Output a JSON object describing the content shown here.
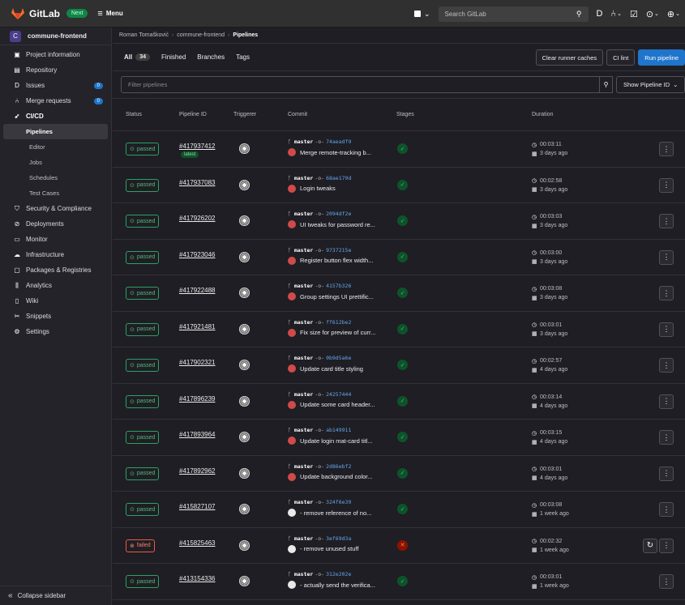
{
  "topbar": {
    "brand": "GitLab",
    "next_badge": "Next",
    "menu_label": "Menu",
    "search_placeholder": "Search GitLab"
  },
  "sidebar": {
    "project_initial": "C",
    "project_name": "commune-frontend",
    "items": [
      {
        "label": "Project information",
        "icon": "info-icon"
      },
      {
        "label": "Repository",
        "icon": "doc-icon"
      },
      {
        "label": "Issues",
        "icon": "issues-icon",
        "count": "0"
      },
      {
        "label": "Merge requests",
        "icon": "merge-request-icon",
        "count": "0"
      },
      {
        "label": "CI/CD",
        "icon": "rocket-icon"
      }
    ],
    "cicd_sub": [
      "Pipelines",
      "Editor",
      "Jobs",
      "Schedules",
      "Test Cases"
    ],
    "items_after": [
      {
        "label": "Security & Compliance",
        "icon": "shield-icon"
      },
      {
        "label": "Deployments",
        "icon": "deployments-icon"
      },
      {
        "label": "Monitor",
        "icon": "monitor-icon"
      },
      {
        "label": "Infrastructure",
        "icon": "cloud-icon"
      },
      {
        "label": "Packages & Registries",
        "icon": "package-icon"
      },
      {
        "label": "Analytics",
        "icon": "chart-icon"
      },
      {
        "label": "Wiki",
        "icon": "book-icon"
      },
      {
        "label": "Snippets",
        "icon": "scissors-icon"
      },
      {
        "label": "Settings",
        "icon": "gear-icon"
      }
    ],
    "collapse_label": "Collapse sidebar"
  },
  "breadcrumb": [
    "Roman Tomašković",
    "commune-frontend",
    "Pipelines"
  ],
  "tabs": [
    {
      "label": "All",
      "count": "34"
    },
    {
      "label": "Finished"
    },
    {
      "label": "Branches"
    },
    {
      "label": "Tags"
    }
  ],
  "actions": {
    "clear_caches": "Clear runner caches",
    "ci_lint": "CI lint",
    "run_pipeline": "Run pipeline"
  },
  "filter": {
    "placeholder": "Filter pipelines",
    "id_dropdown": "Show Pipeline ID"
  },
  "columns": [
    "Status",
    "Pipeline ID",
    "Triggerer",
    "Commit",
    "Stages",
    "Duration"
  ],
  "pipelines": [
    {
      "status": "passed",
      "id": "#417937412",
      "latest": "latest",
      "branch": "master",
      "sha": "74aeadf9",
      "message": "Merge remote-tracking b...",
      "avatar": "red",
      "duration": "00:03:11",
      "finished": "3 days ago"
    },
    {
      "status": "passed",
      "id": "#417937083",
      "branch": "master",
      "sha": "68ae179d",
      "message": "Login tweaks",
      "avatar": "red",
      "duration": "00:02:58",
      "finished": "3 days ago"
    },
    {
      "status": "passed",
      "id": "#417926202",
      "branch": "master",
      "sha": "2094df2e",
      "message": "UI tweaks for password re...",
      "avatar": "red",
      "duration": "00:03:03",
      "finished": "3 days ago"
    },
    {
      "status": "passed",
      "id": "#417923046",
      "branch": "master",
      "sha": "9737215e",
      "message": "Register button flex width...",
      "avatar": "red",
      "duration": "00:03:00",
      "finished": "3 days ago"
    },
    {
      "status": "passed",
      "id": "#417922488",
      "branch": "master",
      "sha": "4157b326",
      "message": "Group settings UI prettific...",
      "avatar": "red",
      "duration": "00:03:08",
      "finished": "3 days ago"
    },
    {
      "status": "passed",
      "id": "#417921481",
      "branch": "master",
      "sha": "ff612be2",
      "message": "Fix size for preview of curr...",
      "avatar": "red",
      "duration": "00:03:01",
      "finished": "3 days ago"
    },
    {
      "status": "passed",
      "id": "#417902321",
      "branch": "master",
      "sha": "0b9d5a6e",
      "message": "Update card title styling",
      "avatar": "red",
      "duration": "00:02:57",
      "finished": "4 days ago"
    },
    {
      "status": "passed",
      "id": "#417896239",
      "branch": "master",
      "sha": "24257444",
      "message": "Update some card header...",
      "avatar": "red",
      "duration": "00:03:14",
      "finished": "4 days ago"
    },
    {
      "status": "passed",
      "id": "#417893964",
      "branch": "master",
      "sha": "ab149911",
      "message": "Update login mat-card titl...",
      "avatar": "red",
      "duration": "00:03:15",
      "finished": "4 days ago"
    },
    {
      "status": "passed",
      "id": "#417892962",
      "branch": "master",
      "sha": "2d86ebf2",
      "message": "Update background color...",
      "avatar": "red",
      "duration": "00:03:01",
      "finished": "4 days ago"
    },
    {
      "status": "passed",
      "id": "#415827107",
      "branch": "master",
      "sha": "324f6e39",
      "message": "- remove reference of no...",
      "avatar": "white",
      "duration": "00:03:08",
      "finished": "1 week ago"
    },
    {
      "status": "failed",
      "id": "#415825463",
      "branch": "master",
      "sha": "3ef69d3a",
      "message": "- remove unused stuff",
      "avatar": "white",
      "duration": "00:02:32",
      "finished": "1 week ago",
      "retry": true
    },
    {
      "status": "passed",
      "id": "#413154336",
      "branch": "master",
      "sha": "312e202e",
      "message": "- actually send the verifica...",
      "avatar": "white",
      "duration": "00:03:01",
      "finished": "1 week ago"
    }
  ]
}
